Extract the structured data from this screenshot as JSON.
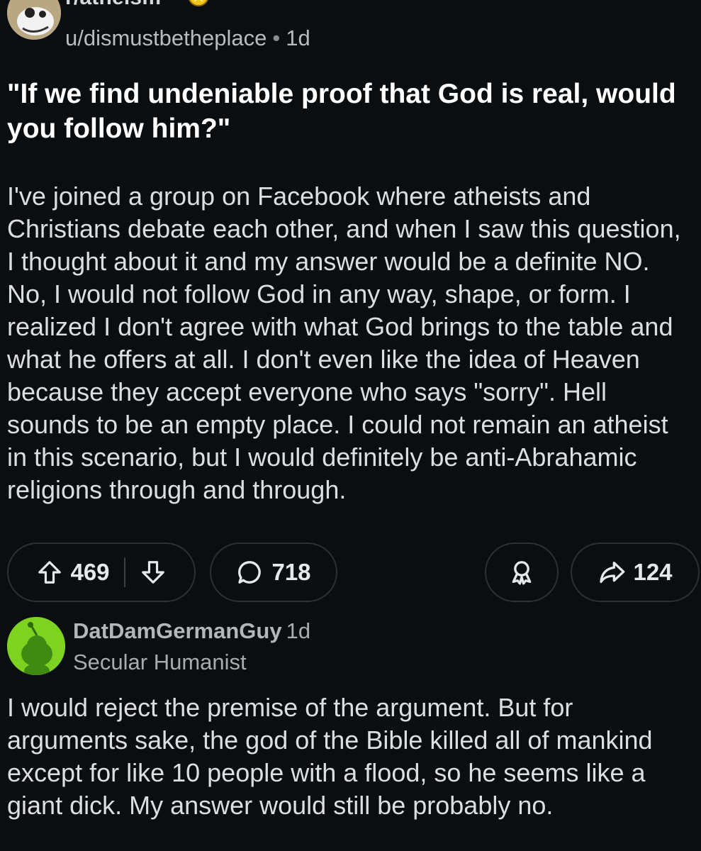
{
  "post": {
    "subreddit": "r/atheism",
    "author": "u/dismustbetheplace",
    "separator": "•",
    "time": "1d",
    "title": "\"If we find undeniable proof that God is real, would you follow him?\"",
    "body": "I've joined a group on Facebook where atheists and Christians debate each other, and when I saw this question, I thought about it and my answer would be a definite NO. No, I would not follow God in any way, shape, or form. I realized I don't agree with what God brings to the table and what he offers at all. I don't even like the idea of Heaven because they accept everyone who says \"sorry\". Hell sounds to be an empty place. I could not remain an atheist in this scenario, but I would definitely be anti-Abrahamic religions through and through.",
    "upvotes": "469",
    "comments": "718",
    "shares": "124"
  },
  "icons": {
    "upvote": "arrow-up-icon",
    "downvote": "arrow-down-icon",
    "comment": "comment-bubble-icon",
    "award": "award-icon",
    "share": "share-icon",
    "badge": "gold-star-badge-icon"
  },
  "comment": {
    "author": "DatDamGermanGuy",
    "time": "1d",
    "flair": "Secular Humanist",
    "body": "I would reject the premise of the argument. But for arguments sake, the god of the Bible killed all of mankind except for like 10 people with a flood, so he seems like a giant dick. My answer would still be probably no."
  },
  "colors": {
    "background": "#0b0e11",
    "text": "#dcdfe1",
    "pill_border": "#2c3034",
    "avatar_green": "#7ed321",
    "badge_gold": "#f5c518"
  }
}
